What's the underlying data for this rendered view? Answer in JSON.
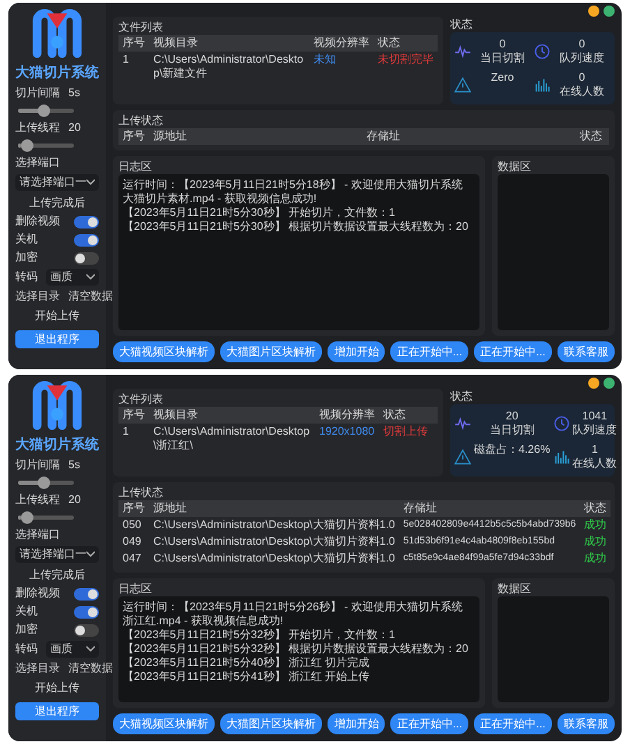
{
  "windows": [
    {
      "sidebar": {
        "logo_title": "大猫切片系统",
        "sliders": [
          {
            "label": "切片间隔",
            "value": "5s",
            "level": 0.45
          },
          {
            "label": "上传线程",
            "value": "20",
            "level": 0.05
          }
        ],
        "port": {
          "label": "选择端口",
          "value": "请选择端口一"
        },
        "after_label": "上传完成后",
        "toggles": [
          {
            "label": "删除视频",
            "on": true
          },
          {
            "label": "关机",
            "on": true
          },
          {
            "label": "加密",
            "on": false
          }
        ],
        "transcode": {
          "label": "转码",
          "value": "画质"
        },
        "links": [
          "选择目录",
          "清空数据"
        ],
        "start": "开始上传",
        "exit": "退出程序"
      },
      "file_list": {
        "title": "文件列表",
        "columns": [
          "序号",
          "视频目录",
          "视频分辨率",
          "状态"
        ],
        "rows": [
          {
            "cells": [
              "1",
              "C:\\Users\\Administrator\\Desktop\\新建文件",
              "未知",
              "未切割完毕"
            ]
          }
        ]
      },
      "status": {
        "title": "状态",
        "stats": [
          {
            "kind": "pulse",
            "value": "0",
            "label": "当日切割"
          },
          {
            "kind": "clock",
            "value": "0",
            "label": "队列速度"
          },
          {
            "kind": "warning",
            "label": "Zero"
          },
          {
            "kind": "bars",
            "value": "0",
            "label": "在线人数"
          }
        ]
      },
      "upload": {
        "title": "上传状态",
        "columns": [
          "序号",
          "源地址",
          "存储址",
          "状态"
        ]
      },
      "log": {
        "title": "日志区",
        "lines": [
          "运行时间：【2023年5月11日21时5分18秒】 - 欢迎使用大猫切片系统",
          "大猫切片素材.mp4 - 获取视频信息成功!",
          "【2023年5月11日21时5分30秒】 开始切片，文件数：1",
          "【2023年5月11日21时5分30秒】 根据切片数据设置最大线程数为：20"
        ]
      },
      "data_area": {
        "title": "数据区"
      },
      "buttons": [
        "大猫视频区块解析",
        "大猫图片区块解析",
        "增加开始",
        "正在开始中...",
        "正在开始中...",
        "联系客服"
      ]
    },
    {
      "sidebar": {
        "logo_title": "大猫切片系统",
        "sliders": [
          {
            "label": "切片间隔",
            "value": "5s",
            "level": 0.45
          },
          {
            "label": "上传线程",
            "value": "20",
            "level": 0.05
          }
        ],
        "port": {
          "label": "选择端口",
          "value": "请选择端口一"
        },
        "after_label": "上传完成后",
        "toggles": [
          {
            "label": "删除视频",
            "on": true
          },
          {
            "label": "关机",
            "on": true
          },
          {
            "label": "加密",
            "on": false
          }
        ],
        "transcode": {
          "label": "转码",
          "value": "画质"
        },
        "links": [
          "选择目录",
          "清空数据"
        ],
        "start": "开始上传",
        "exit": "退出程序"
      },
      "file_list": {
        "title": "文件列表",
        "columns": [
          "序号",
          "视频目录",
          "视频分辨率",
          "状态"
        ],
        "rows": [
          {
            "cells": [
              "1",
              "C:\\Users\\Administrator\\Desktop\\浙江红\\",
              "1920x1080",
              "切割上传"
            ]
          }
        ]
      },
      "status": {
        "title": "状态",
        "stats": [
          {
            "kind": "pulse",
            "value": "20",
            "label": "当日切割"
          },
          {
            "kind": "clock",
            "value": "1041",
            "label": "队列速度"
          },
          {
            "kind": "warning",
            "label": "磁盘占：4.26%"
          },
          {
            "kind": "bars",
            "value": "1",
            "label": "在线人数"
          }
        ]
      },
      "upload": {
        "title": "上传状态",
        "columns": [
          "序号",
          "源地址",
          "存储址",
          "状态"
        ],
        "rows": [
          {
            "cells": [
              "050",
              "C:\\Users\\Administrator\\Desktop\\大猫切片资料1.0",
              "5e028402809e4412b5c5c5b4abd739b6",
              "成功"
            ]
          },
          {
            "cells": [
              "049",
              "C:\\Users\\Administrator\\Desktop\\大猫切片资料1.0",
              "51d53b6f91e4c4ab4809f8eb155bd",
              "成功"
            ]
          },
          {
            "cells": [
              "047",
              "C:\\Users\\Administrator\\Desktop\\大猫切片资料1.0",
              "c5t85e9c4ae84f99a5fe7d94c33bdf",
              "成功"
            ]
          }
        ]
      },
      "log": {
        "title": "日志区",
        "lines": [
          "运行时间：【2023年5月11日21时5分26秒】 - 欢迎使用大猫切片系统",
          "浙江红.mp4 - 获取视频信息成功!",
          "【2023年5月11日21时5分32秒】 开始切片，文件数：1",
          "【2023年5月11日21时5分32秒】 根据切片数据设置最大线程数为：20",
          "【2023年5月11日21时5分40秒】 浙江红 切片完成",
          "【2023年5月11日21时5分41秒】 浙江红 开始上传"
        ]
      },
      "data_area": {
        "title": "数据区"
      },
      "buttons": [
        "大猫视频区块解析",
        "大猫图片区块解析",
        "增加开始",
        "正在开始中...",
        "正在开始中...",
        "联系客服"
      ]
    }
  ]
}
